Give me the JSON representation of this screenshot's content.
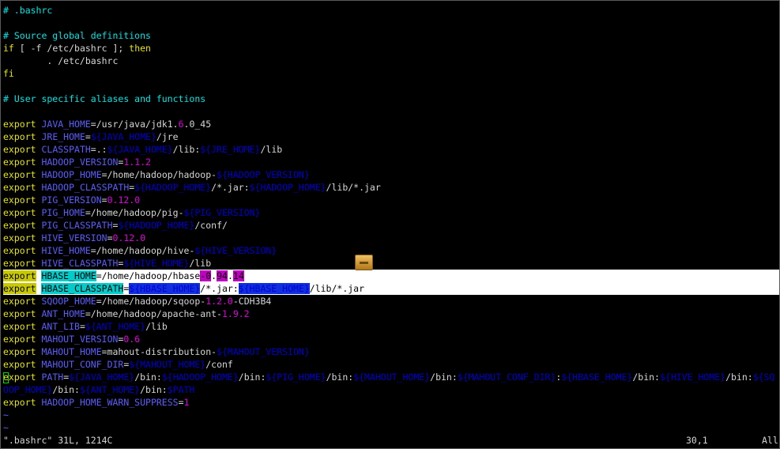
{
  "editor": {
    "lines": [
      {
        "segs": [
          {
            "t": "# .bashrc",
            "c": "comment"
          }
        ]
      },
      {
        "segs": []
      },
      {
        "segs": [
          {
            "t": "# Source global definitions",
            "c": "comment"
          }
        ]
      },
      {
        "segs": [
          {
            "t": "if",
            "c": "kw"
          },
          {
            "t": " [ -f /etc/bashrc ]; ",
            "c": "sym"
          },
          {
            "t": "then",
            "c": "kw"
          }
        ]
      },
      {
        "segs": [
          {
            "t": "        . /etc/bashrc",
            "c": "sym"
          }
        ]
      },
      {
        "segs": [
          {
            "t": "fi",
            "c": "kw"
          }
        ]
      },
      {
        "segs": []
      },
      {
        "segs": [
          {
            "t": "# User specific aliases and functions",
            "c": "comment"
          }
        ]
      },
      {
        "segs": []
      },
      {
        "segs": [
          {
            "t": "export",
            "c": "kw"
          },
          {
            "t": " ",
            "c": "sym"
          },
          {
            "t": "JAVA_HOME",
            "c": "id"
          },
          {
            "t": "=/usr/java/jdk1.",
            "c": "sym"
          },
          {
            "t": "6",
            "c": "num"
          },
          {
            "t": ".0_45",
            "c": "sym"
          }
        ]
      },
      {
        "segs": [
          {
            "t": "export",
            "c": "kw"
          },
          {
            "t": " ",
            "c": "sym"
          },
          {
            "t": "JRE_HOME",
            "c": "id"
          },
          {
            "t": "=",
            "c": "sym"
          },
          {
            "t": "${JAVA_HOME}",
            "c": "var"
          },
          {
            "t": "/jre",
            "c": "sym"
          }
        ]
      },
      {
        "segs": [
          {
            "t": "export",
            "c": "kw"
          },
          {
            "t": " ",
            "c": "sym"
          },
          {
            "t": "CLASSPATH",
            "c": "id"
          },
          {
            "t": "=.:",
            "c": "sym"
          },
          {
            "t": "${JAVA_HOME}",
            "c": "var"
          },
          {
            "t": "/lib:",
            "c": "sym"
          },
          {
            "t": "${JRE_HOME}",
            "c": "var"
          },
          {
            "t": "/lib",
            "c": "sym"
          }
        ]
      },
      {
        "segs": [
          {
            "t": "export",
            "c": "kw"
          },
          {
            "t": " ",
            "c": "sym"
          },
          {
            "t": "HADOOP_VERSION",
            "c": "id"
          },
          {
            "t": "=",
            "c": "sym"
          },
          {
            "t": "1.1.2",
            "c": "num"
          }
        ]
      },
      {
        "segs": [
          {
            "t": "export",
            "c": "kw"
          },
          {
            "t": " ",
            "c": "sym"
          },
          {
            "t": "HADOOP_HOME",
            "c": "id"
          },
          {
            "t": "=/home/hadoop/hadoop-",
            "c": "sym"
          },
          {
            "t": "${HADOOP_VERSION}",
            "c": "var"
          }
        ]
      },
      {
        "segs": [
          {
            "t": "export",
            "c": "kw"
          },
          {
            "t": " ",
            "c": "sym"
          },
          {
            "t": "HADOOP_CLASSPATH",
            "c": "id"
          },
          {
            "t": "=",
            "c": "sym"
          },
          {
            "t": "${HADOOP_HOME}",
            "c": "var"
          },
          {
            "t": "/*.jar:",
            "c": "sym"
          },
          {
            "t": "${HADOOP_HOME}",
            "c": "var"
          },
          {
            "t": "/lib/*.jar",
            "c": "sym"
          }
        ]
      },
      {
        "segs": [
          {
            "t": "export",
            "c": "kw"
          },
          {
            "t": " ",
            "c": "sym"
          },
          {
            "t": "PIG_VERSION",
            "c": "id"
          },
          {
            "t": "=",
            "c": "sym"
          },
          {
            "t": "0.12.0",
            "c": "num"
          }
        ]
      },
      {
        "segs": [
          {
            "t": "export",
            "c": "kw"
          },
          {
            "t": " ",
            "c": "sym"
          },
          {
            "t": "PIG_HOME",
            "c": "id"
          },
          {
            "t": "=/home/hadoop/pig-",
            "c": "sym"
          },
          {
            "t": "${PIG_VERSION}",
            "c": "var"
          }
        ]
      },
      {
        "segs": [
          {
            "t": "export",
            "c": "kw"
          },
          {
            "t": " ",
            "c": "sym"
          },
          {
            "t": "PIG_CLASSPATH",
            "c": "id"
          },
          {
            "t": "=",
            "c": "sym"
          },
          {
            "t": "${HADOOP_HOME}",
            "c": "var"
          },
          {
            "t": "/conf/",
            "c": "sym"
          }
        ]
      },
      {
        "segs": [
          {
            "t": "export",
            "c": "kw"
          },
          {
            "t": " ",
            "c": "sym"
          },
          {
            "t": "HIVE_VERSION",
            "c": "id"
          },
          {
            "t": "=",
            "c": "sym"
          },
          {
            "t": "0.12.0",
            "c": "num"
          }
        ]
      },
      {
        "segs": [
          {
            "t": "export",
            "c": "kw"
          },
          {
            "t": " ",
            "c": "sym"
          },
          {
            "t": "HIVE_HOME",
            "c": "id"
          },
          {
            "t": "=/home/hadoop/hive-",
            "c": "sym"
          },
          {
            "t": "${HIVE_VERSION}",
            "c": "var"
          }
        ]
      },
      {
        "segs": [
          {
            "t": "export",
            "c": "kw"
          },
          {
            "t": " ",
            "c": "sym"
          },
          {
            "t": "HIVE_CLASSPATH",
            "c": "id"
          },
          {
            "t": "=",
            "c": "sym"
          },
          {
            "t": "${HIVE_HOME}",
            "c": "var"
          },
          {
            "t": "/lib",
            "c": "sym"
          }
        ]
      },
      {
        "hl": true,
        "segs": [
          {
            "t": "export",
            "c": "kw"
          },
          {
            "t": " ",
            "c": "sym"
          },
          {
            "t": "HBASE_HOME",
            "c": "id"
          },
          {
            "t": "=/home/hadoop/hbase",
            "c": "sym"
          },
          {
            "t": "-0",
            "c": "num"
          },
          {
            "t": ".",
            "c": "sym"
          },
          {
            "t": "94",
            "c": "num"
          },
          {
            "t": ".",
            "c": "sym"
          },
          {
            "t": "14",
            "c": "num"
          }
        ]
      },
      {
        "hl": true,
        "segs": [
          {
            "t": "export",
            "c": "kw"
          },
          {
            "t": " ",
            "c": "sym"
          },
          {
            "t": "HBASE_CLASSPATH",
            "c": "id"
          },
          {
            "t": "=",
            "c": "sym"
          },
          {
            "t": "${HBASE_HOME}",
            "c": "var"
          },
          {
            "t": "/*.jar:",
            "c": "sym"
          },
          {
            "t": "${HBASE_HOME}",
            "c": "var"
          },
          {
            "t": "/lib/*.jar",
            "c": "sym"
          }
        ]
      },
      {
        "segs": [
          {
            "t": "export",
            "c": "kw"
          },
          {
            "t": " ",
            "c": "sym"
          },
          {
            "t": "SQOOP_HOME",
            "c": "id"
          },
          {
            "t": "=/home/hadoop/sqoop-",
            "c": "sym"
          },
          {
            "t": "1.2.0",
            "c": "num"
          },
          {
            "t": "-CDH3B4",
            "c": "sym"
          }
        ]
      },
      {
        "segs": [
          {
            "t": "export",
            "c": "kw"
          },
          {
            "t": " ",
            "c": "sym"
          },
          {
            "t": "ANT_HOME",
            "c": "id"
          },
          {
            "t": "=/home/hadoop/apache-ant-",
            "c": "sym"
          },
          {
            "t": "1.9.2",
            "c": "num"
          }
        ]
      },
      {
        "segs": [
          {
            "t": "export",
            "c": "kw"
          },
          {
            "t": " ",
            "c": "sym"
          },
          {
            "t": "ANT_LIB",
            "c": "id"
          },
          {
            "t": "=",
            "c": "sym"
          },
          {
            "t": "${ANT_HOME}",
            "c": "var"
          },
          {
            "t": "/lib",
            "c": "sym"
          }
        ]
      },
      {
        "segs": [
          {
            "t": "export",
            "c": "kw"
          },
          {
            "t": " ",
            "c": "sym"
          },
          {
            "t": "MAHOUT_VERSION",
            "c": "id"
          },
          {
            "t": "=",
            "c": "sym"
          },
          {
            "t": "0.6",
            "c": "num"
          }
        ]
      },
      {
        "segs": [
          {
            "t": "export",
            "c": "kw"
          },
          {
            "t": " ",
            "c": "sym"
          },
          {
            "t": "MAHOUT_HOME",
            "c": "id"
          },
          {
            "t": "=mahout-distribution-",
            "c": "sym"
          },
          {
            "t": "${MAHOUT_VERSION}",
            "c": "var"
          }
        ]
      },
      {
        "segs": [
          {
            "t": "export",
            "c": "kw"
          },
          {
            "t": " ",
            "c": "sym"
          },
          {
            "t": "MAHOUT_CONF_DIR",
            "c": "id"
          },
          {
            "t": "=",
            "c": "sym"
          },
          {
            "t": "${MAHOUT_HOME}",
            "c": "var"
          },
          {
            "t": "/conf",
            "c": "sym"
          }
        ]
      },
      {
        "segs": [
          {
            "t": "export",
            "c": "kw"
          },
          {
            "t": " ",
            "c": "sym"
          },
          {
            "t": "PATH",
            "c": "id"
          },
          {
            "t": "=",
            "c": "sym"
          },
          {
            "t": "${JAVA_HOME}",
            "c": "var"
          },
          {
            "t": "/bin:",
            "c": "sym"
          },
          {
            "t": "${HADOOP_HOME}",
            "c": "var"
          },
          {
            "t": "/bin:",
            "c": "sym"
          },
          {
            "t": "${PIG_HOME}",
            "c": "var"
          },
          {
            "t": "/bin:",
            "c": "sym"
          },
          {
            "t": "${MAHOUT_HOME}",
            "c": "var"
          },
          {
            "t": "/bin:",
            "c": "sym"
          },
          {
            "t": "${MAHOUT_CONF_DIR}",
            "c": "var"
          },
          {
            "t": ":",
            "c": "sym"
          },
          {
            "t": "${HBASE_HOME}",
            "c": "var"
          },
          {
            "t": "/bin:",
            "c": "sym"
          },
          {
            "t": "${HIVE_HOME}",
            "c": "var"
          },
          {
            "t": "/bin:",
            "c": "sym"
          },
          {
            "t": "${SQ",
            "c": "var"
          }
        ]
      },
      {
        "segs": [
          {
            "t": "OOP_HOME}",
            "c": "var"
          },
          {
            "t": "/bin:",
            "c": "sym"
          },
          {
            "t": "${ANT_HOME}",
            "c": "var"
          },
          {
            "t": "/bin:",
            "c": "sym"
          },
          {
            "t": "$PATH",
            "c": "var"
          }
        ]
      },
      {
        "segs": [
          {
            "t": "export",
            "c": "kw"
          },
          {
            "t": " ",
            "c": "sym"
          },
          {
            "t": "HADOOP_HOME_WARN_SUPPRESS",
            "c": "id"
          },
          {
            "t": "=",
            "c": "sym"
          },
          {
            "t": "1",
            "c": "num"
          }
        ]
      },
      {
        "segs": [
          {
            "t": "~",
            "c": "tilde"
          }
        ]
      },
      {
        "segs": [
          {
            "t": "~",
            "c": "tilde"
          }
        ]
      }
    ]
  },
  "status": {
    "file": "\".bashrc\" 31L, 1214C",
    "position": "30,1",
    "scroll": "All"
  },
  "colors": {
    "background": "#000000",
    "keyword": "#e5e500",
    "identifier": "#5c5cff",
    "comment": "#00e5e5",
    "number": "#e000e0",
    "variable": "#0000cd"
  }
}
